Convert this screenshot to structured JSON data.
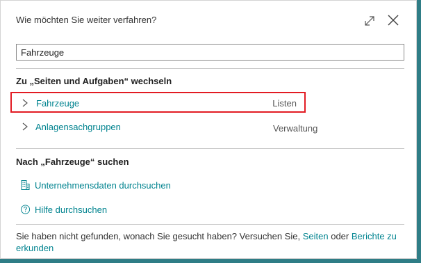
{
  "dialog": {
    "title": "Wie möchten Sie weiter verfahren?",
    "expand_icon": "expand-icon",
    "close_icon": "close-icon"
  },
  "search": {
    "value": "Fahrzeuge",
    "placeholder": ""
  },
  "pages_section": {
    "heading": "Zu „Seiten und Aufgaben“ wechseln",
    "results": [
      {
        "label": "Fahrzeuge",
        "category": "Listen",
        "icon": "chevron-right-icon",
        "highlighted": true
      },
      {
        "label": "Anlagensachgruppen",
        "category": "Verwaltung",
        "icon": "chevron-right-icon",
        "highlighted": false
      }
    ]
  },
  "search_section": {
    "heading": "Nach „Fahrzeuge“ suchen",
    "actions": [
      {
        "label": "Unternehmensdaten durchsuchen",
        "icon": "building-icon"
      },
      {
        "label": "Hilfe durchsuchen",
        "icon": "help-circle-icon"
      }
    ]
  },
  "footer": {
    "text_before": "Sie haben nicht gefunden, wonach Sie gesucht haben? Versuchen Sie,",
    "link_pages": "Seiten",
    "text_middle": "oder",
    "link_reports": "Berichte zu erkunden"
  },
  "colors": {
    "accent": "#00838f",
    "highlight_border": "#e21b23",
    "background": "#1f6f78"
  }
}
